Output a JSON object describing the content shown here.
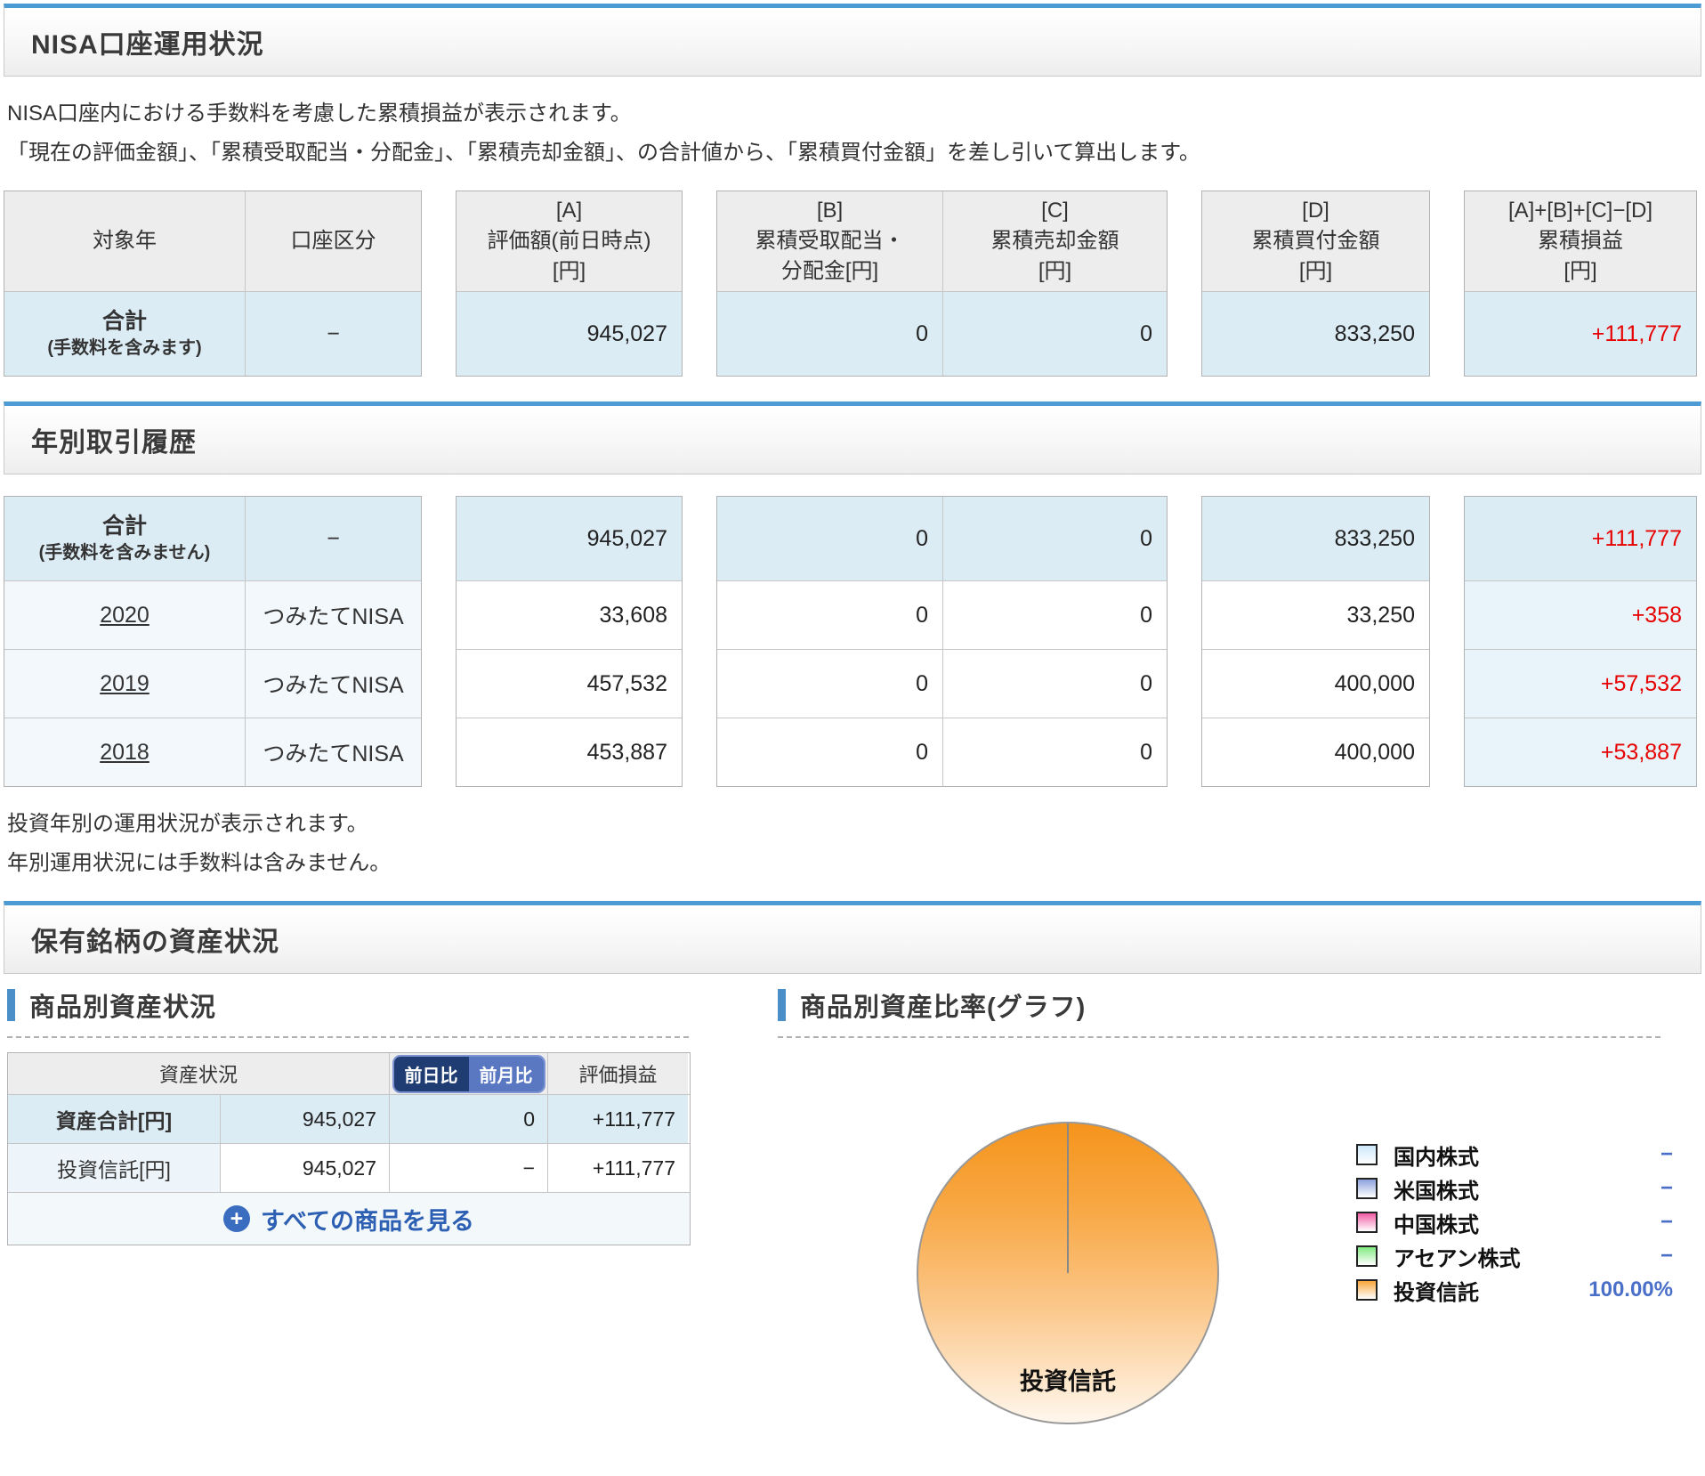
{
  "colors": {
    "accent_blue": "#4d9bd5",
    "panel_bar_blue": "#4a8fc7",
    "total_row_bg": "#dcecf5",
    "profit_red": "#e60000",
    "legend_value_blue": "#4a6fc8",
    "toggle_day_bg": "#203d73",
    "toggle_month_bg": "#5a78c2",
    "pie_orange": "#f5941c"
  },
  "nisa_section": {
    "title": "NISA口座運用状況",
    "description_lines": [
      "NISA口座内における手数料を考慮した累積損益が表示されます。",
      "「現在の評価金額」、「累積受取配当・分配金」、「累積売却金額」、の合計値から、「累積買付金額」を差し引いて算出します。"
    ]
  },
  "table_headers": {
    "year": "対象年",
    "type": "口座区分",
    "a": [
      "[A]",
      "評価額(前日時点)",
      "[円]"
    ],
    "b": [
      "[B]",
      "累積受取配当・",
      "分配金[円]"
    ],
    "c": [
      "[C]",
      "累積売却金額",
      "[円]"
    ],
    "d": [
      "[D]",
      "累積買付金額",
      "[円]"
    ],
    "pl": [
      "[A]+[B]+[C]−[D]",
      "累積損益",
      "[円]"
    ]
  },
  "summary_total": {
    "label": "合計",
    "note": "(手数料を含みます)",
    "type": "−",
    "a": "945,027",
    "b": "0",
    "c": "0",
    "d": "833,250",
    "pl": "+111,777"
  },
  "yearly_section": {
    "title": "年別取引履歴",
    "total": {
      "label": "合計",
      "note": "(手数料を含みません)",
      "type": "−",
      "a": "945,027",
      "b": "0",
      "c": "0",
      "d": "833,250",
      "pl": "+111,777"
    },
    "rows": [
      {
        "year": "2020",
        "type": "つみたてNISA",
        "a": "33,608",
        "b": "0",
        "c": "0",
        "d": "33,250",
        "pl": "+358"
      },
      {
        "year": "2019",
        "type": "つみたてNISA",
        "a": "457,532",
        "b": "0",
        "c": "0",
        "d": "400,000",
        "pl": "+57,532"
      },
      {
        "year": "2018",
        "type": "つみたてNISA",
        "a": "453,887",
        "b": "0",
        "c": "0",
        "d": "400,000",
        "pl": "+53,887"
      }
    ],
    "notes": [
      "投資年別の運用状況が表示されます。",
      "年別運用状況には手数料は含みません。"
    ]
  },
  "holdings_section": {
    "title": "保有銘柄の資産状況",
    "assets_panel": {
      "title": "商品別資産状況",
      "header_left": "資産状況",
      "header_right": "評価損益",
      "toggle": {
        "day": "前日比",
        "month": "前月比"
      },
      "rows": [
        {
          "label": "資産合計[円]",
          "value": "945,027",
          "diff": "0",
          "pl": "+111,777"
        },
        {
          "label": "投資信託[円]",
          "value": "945,027",
          "diff": "−",
          "pl": "+111,777"
        }
      ],
      "see_all": "すべての商品を見る",
      "plus": "+"
    },
    "ratio_panel": {
      "title": "商品別資産比率(グラフ)",
      "pie_label": "投資信託",
      "legend": [
        {
          "label": "国内株式",
          "value": "−",
          "color": "#cde7fa"
        },
        {
          "label": "米国株式",
          "value": "−",
          "color": "#8da2dd"
        },
        {
          "label": "中国株式",
          "value": "−",
          "color": "#f25ca5"
        },
        {
          "label": "アセアン株式",
          "value": "−",
          "color": "#80e980"
        },
        {
          "label": "投資信託",
          "value": "100.00%",
          "color": "#f8a63a"
        }
      ]
    }
  },
  "chart_data": {
    "type": "pie",
    "title": "商品別資産比率(グラフ)",
    "slices": [
      {
        "label": "投資信託",
        "value": 100.0
      }
    ],
    "legend_entries": [
      {
        "label": "国内株式",
        "value": null
      },
      {
        "label": "米国株式",
        "value": null
      },
      {
        "label": "中国株式",
        "value": null
      },
      {
        "label": "アセアン株式",
        "value": null
      },
      {
        "label": "投資信託",
        "value": 100.0
      }
    ],
    "legend_position": "right",
    "center_label": "投資信託"
  }
}
